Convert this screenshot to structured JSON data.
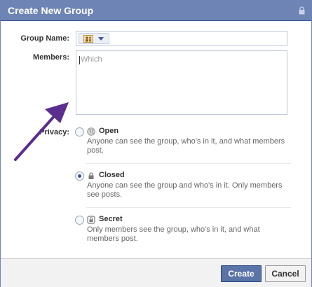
{
  "dialog": {
    "title": "Create New Group",
    "title_icon": "lock-icon"
  },
  "form": {
    "group_name_label": "Group Name:",
    "group_name_value": "",
    "group_icon": "group-avatar-icon",
    "members_label": "Members:",
    "members_placeholder": "Which",
    "privacy_label": "Privacy:"
  },
  "privacy_options": [
    {
      "title": "Open",
      "icon": "globe-icon",
      "selected": false,
      "description": "Anyone can see the group, who's in it, and what members post."
    },
    {
      "title": "Closed",
      "icon": "lock-icon",
      "selected": true,
      "description": "Anyone can see the group and who's in it. Only members see posts."
    },
    {
      "title": "Secret",
      "icon": "padlock-icon",
      "selected": false,
      "description": "Only members see the group, who's in it, and what members post."
    }
  ],
  "footer": {
    "create_label": "Create",
    "cancel_label": "Cancel"
  },
  "annotation": {
    "arrow_color": "#5b2d8e"
  }
}
